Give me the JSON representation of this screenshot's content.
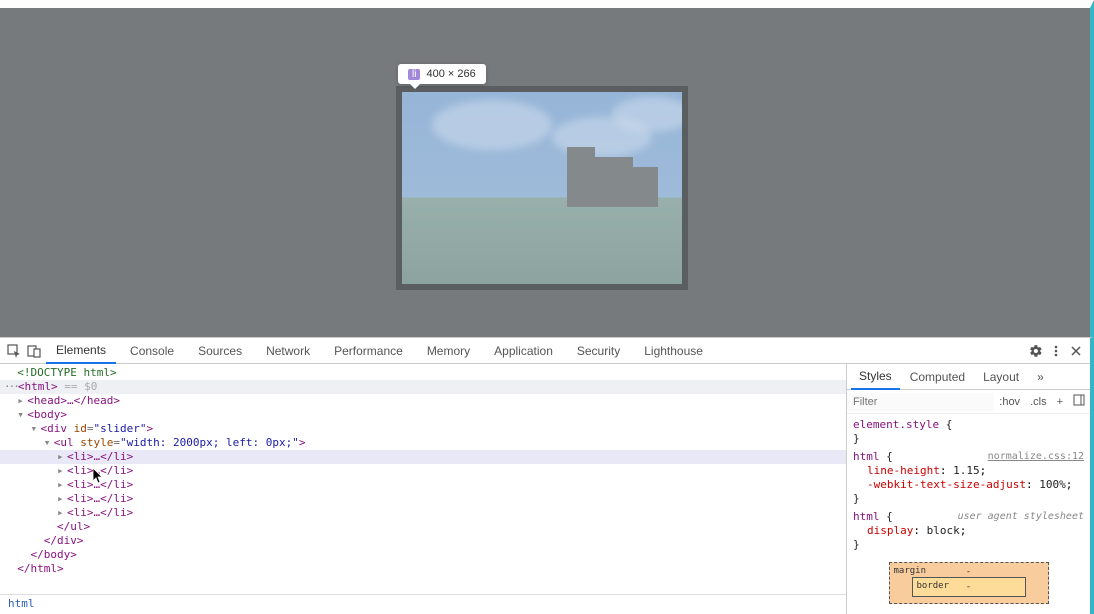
{
  "tooltip": {
    "tag": "li",
    "dims": "400 × 266"
  },
  "devtools": {
    "tabs": [
      "Elements",
      "Console",
      "Sources",
      "Network",
      "Performance",
      "Memory",
      "Application",
      "Security",
      "Lighthouse"
    ],
    "active_tab": "Elements"
  },
  "dom": {
    "l0": "<!DOCTYPE html>",
    "l1_open": "<html>",
    "l1_extra": " == $0",
    "l2": "<head>…</head>",
    "l3": "<body>",
    "l4_open": "<div ",
    "l4_attr": "id",
    "l4_val": "\"slider\"",
    "l4_close": ">",
    "l5_open": "<ul ",
    "l5_attr": "style",
    "l5_val": "\"width: 2000px; left: 0px;\"",
    "l5_close": ">",
    "li": "<li>…</li>",
    "ul_end": "</ul>",
    "div_end": "</div>",
    "body_end": "</body>",
    "html_end": "</html>"
  },
  "crumb": "html",
  "styles": {
    "tabs": [
      "Styles",
      "Computed",
      "Layout"
    ],
    "filter_ph": "Filter",
    "hov": ":hov",
    "cls": ".cls",
    "r1_sel": "element.style",
    "r2_sel": "html",
    "r2_src": "normalize.css:12",
    "r2_p1n": "line-height",
    "r2_p1v": "1.15",
    "r2_p2n": "-webkit-text-size-adjust",
    "r2_p2v": "100%",
    "r3_sel": "html",
    "r3_src": "user agent stylesheet",
    "r3_p1n": "display",
    "r3_p1v": "block"
  },
  "boxmodel": {
    "margin": "margin",
    "border": "border",
    "dash": "-"
  }
}
